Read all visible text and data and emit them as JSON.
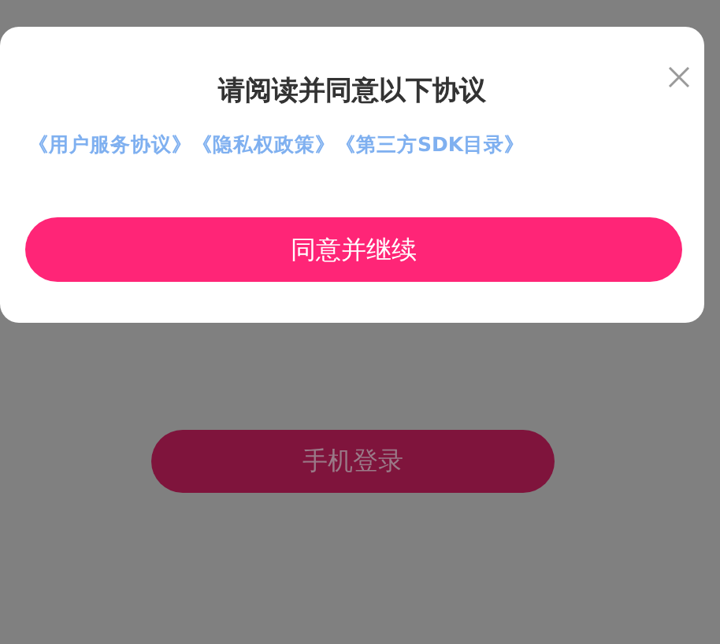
{
  "dialog": {
    "title": "请阅读并同意以下协议",
    "links": [
      {
        "label": "《用户服务协议》"
      },
      {
        "label": "《隐私权政策》"
      },
      {
        "label": "《第三方SDK目录》"
      }
    ],
    "confirm_button": "同意并继续"
  },
  "login_button": "手机登录"
}
